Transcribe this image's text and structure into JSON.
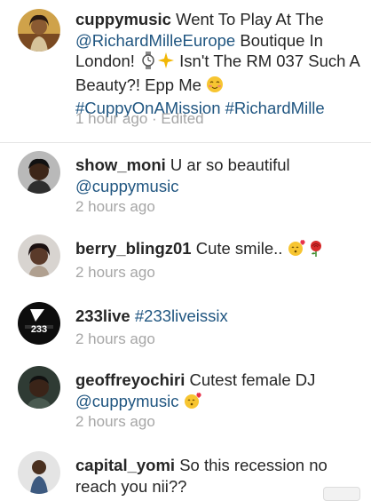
{
  "caption": {
    "username": "cuppymusic",
    "text_before": "Went To Play At The",
    "mention": "@RichardMilleEurope",
    "text_mid": "Boutique In London!",
    "icons": [
      "watch-emoji-icon",
      "sparkles-emoji-icon"
    ],
    "text_after": "Isn't The RM 037 Such A Beauty?! Epp Me",
    "emoji": "blushing-face-emoji-icon",
    "hashtags": [
      "#CuppyOnAMission",
      "#RichardMille"
    ],
    "time": "1 hour ago",
    "edited": "Edited"
  },
  "comments": [
    {
      "username": "show_moni",
      "text": "U ar so beautiful",
      "mention": "@cuppymusic",
      "time": "2 hours ago",
      "avatar": "avatar-show-moni"
    },
    {
      "username": "berry_blingz01",
      "text": "Cute smile..",
      "icons": [
        "kissing-heart-emoji-icon",
        "rose-emoji-icon"
      ],
      "time": "2 hours ago",
      "avatar": "avatar-berry-blingz01"
    },
    {
      "username": "233live",
      "hashtag": "#233liveissix",
      "time": "2 hours ago",
      "avatar": "avatar-233live",
      "avatar_text": "233"
    },
    {
      "username": "geoffreyochiri",
      "text": "Cutest female DJ",
      "mention": "@cuppymusic",
      "icons": [
        "kissing-heart-emoji-icon"
      ],
      "time": "2 hours ago",
      "avatar": "avatar-geoffreyochiri"
    },
    {
      "username": "capital_yomi",
      "text": "So this recession no reach you nii??",
      "avatar": "avatar-capital-yomi"
    }
  ],
  "colors": {
    "link": "#1f5580",
    "text": "#262626",
    "time": "#a6a6a6"
  }
}
